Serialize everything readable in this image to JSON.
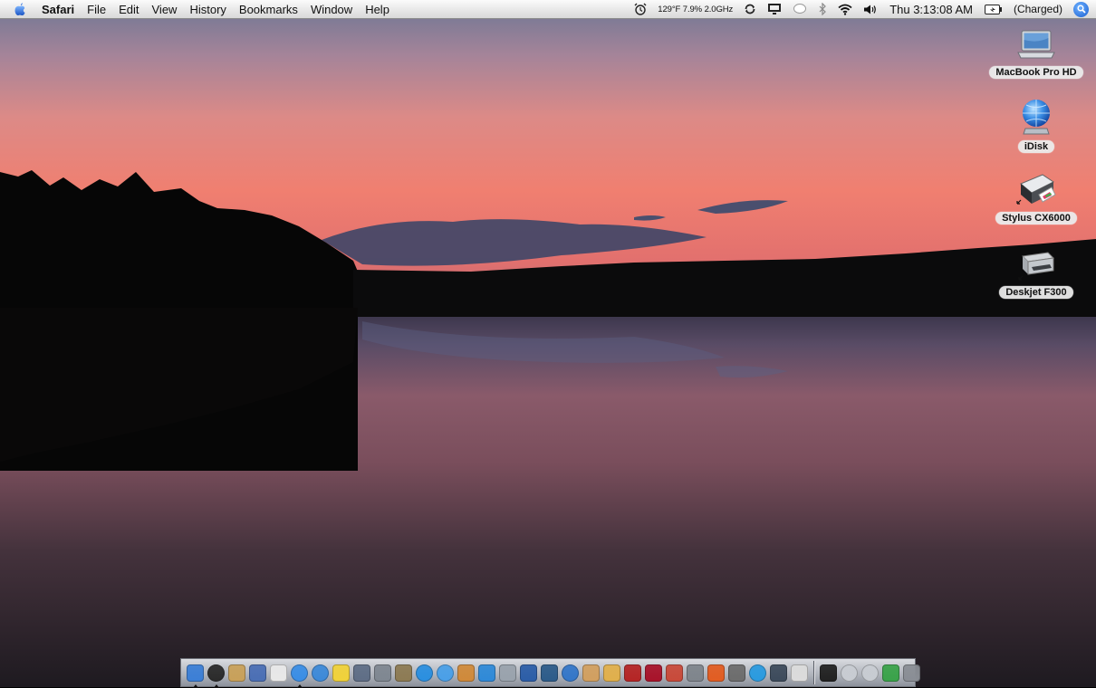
{
  "menubar": {
    "app_name": "Safari",
    "menus": [
      "File",
      "Edit",
      "View",
      "History",
      "Bookmarks",
      "Window",
      "Help"
    ],
    "status": {
      "alarm_icon": "alarm-clock-icon",
      "system_stats": "129°F 7.9% 2.0GHz",
      "clock": "Thu 3:13:08 AM",
      "battery_text": "(Charged)"
    }
  },
  "desktop": {
    "icons": [
      {
        "label": "MacBook Pro HD",
        "icon": "hard-drive-icon"
      },
      {
        "label": "iDisk",
        "icon": "idisk-globe-icon"
      },
      {
        "label": "Stylus CX6000",
        "icon": "printer-icon"
      },
      {
        "label": "Deskjet F300",
        "icon": "printer-icon"
      }
    ]
  },
  "dock": {
    "apps": [
      {
        "name": "finder",
        "color": "#3c7fd6",
        "running": true
      },
      {
        "name": "dashboard",
        "color": "#2b2b2b",
        "running": true,
        "round": true
      },
      {
        "name": "address-book",
        "color": "#c9a15a"
      },
      {
        "name": "preview",
        "color": "#4b6fb5"
      },
      {
        "name": "ical",
        "color": "#e9e9e9"
      },
      {
        "name": "safari",
        "color": "#3a8ee6",
        "running": true,
        "round": true
      },
      {
        "name": "ichat",
        "color": "#3d8ad9",
        "round": true
      },
      {
        "name": "stickies",
        "color": "#f1d23a"
      },
      {
        "name": "script-editor",
        "color": "#5f6e86"
      },
      {
        "name": "system-preferences",
        "color": "#7f8791"
      },
      {
        "name": "automator",
        "color": "#8d7b54"
      },
      {
        "name": "network-utility",
        "color": "#2a8fe0",
        "round": true
      },
      {
        "name": "itunes",
        "color": "#4aa0e8",
        "round": true
      },
      {
        "name": "iphoto",
        "color": "#d08a3a"
      },
      {
        "name": "imovie",
        "color": "#2f8ad8"
      },
      {
        "name": "idvd",
        "color": "#9aa3ad"
      },
      {
        "name": "iweb",
        "color": "#2c5ea8"
      },
      {
        "name": "keynote",
        "color": "#2d5c8a"
      },
      {
        "name": "dvd-player",
        "color": "#3477c9",
        "round": true
      },
      {
        "name": "garageband",
        "color": "#d2a060"
      },
      {
        "name": "pages",
        "color": "#e1b04c"
      },
      {
        "name": "dictionary",
        "color": "#b52525"
      },
      {
        "name": "photo-booth",
        "color": "#a8132a"
      },
      {
        "name": "textedit",
        "color": "#c94a3a"
      },
      {
        "name": "calculator",
        "color": "#7f858c"
      },
      {
        "name": "umbrella-app",
        "color": "#e25d22"
      },
      {
        "name": "disk-utility",
        "color": "#6d6d6d"
      },
      {
        "name": "app-store",
        "color": "#2a9be0",
        "round": true
      },
      {
        "name": "terminal",
        "color": "#3d4b5c"
      },
      {
        "name": "activity-monitor",
        "color": "#dcdcdc"
      }
    ],
    "right_items": [
      {
        "name": "downloads-stack",
        "color": "#222222"
      },
      {
        "name": "applications-folder",
        "color": "#c8ccd2",
        "round": true
      },
      {
        "name": "documents-folder",
        "color": "#c8ccd2",
        "round": true
      },
      {
        "name": "screen-sharing",
        "color": "#3aa34a"
      },
      {
        "name": "trash",
        "color": "#8a8e95"
      }
    ]
  }
}
